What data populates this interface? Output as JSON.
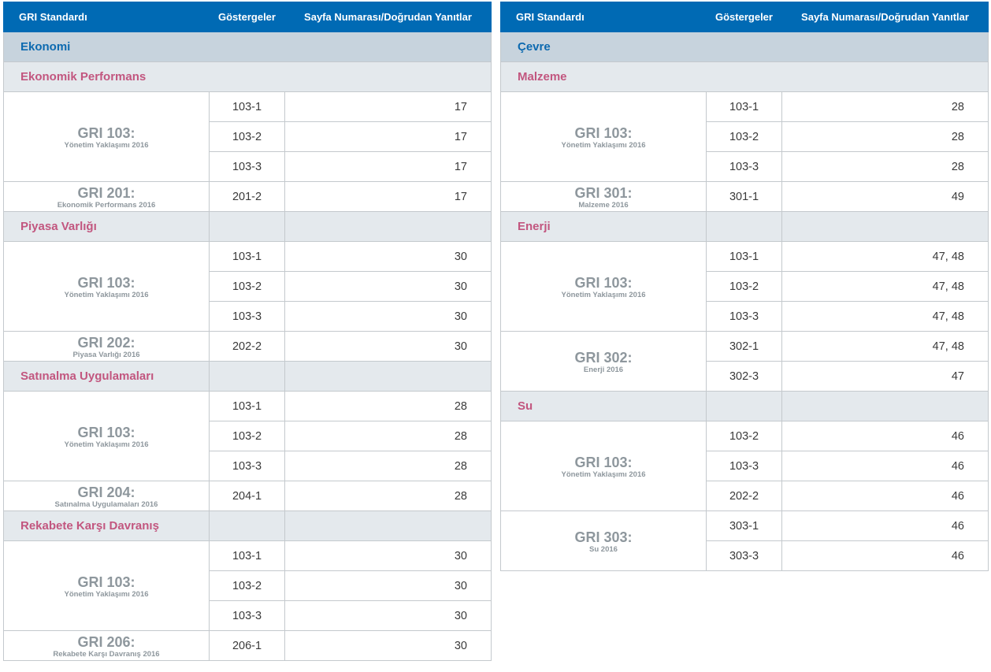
{
  "headers": {
    "standard": "GRI Standardı",
    "indicators": "Göstergeler",
    "pages": "Sayfa Numarası/Doğrudan Yanıtlar"
  },
  "left": {
    "category": "Ekonomi",
    "sections": [
      {
        "title": "Ekonomik Performans",
        "groups": [
          {
            "code": "GRI 103:",
            "name": "Yönetim Yaklaşımı 2016",
            "rows": [
              {
                "ind": "103-1",
                "page": "17"
              },
              {
                "ind": "103-2",
                "page": "17"
              },
              {
                "ind": "103-3",
                "page": "17"
              }
            ]
          },
          {
            "code": "GRI 201:",
            "name": "Ekonomik Performans 2016",
            "rows": [
              {
                "ind": "201-2",
                "page": "17"
              }
            ]
          }
        ]
      },
      {
        "title": "Piyasa Varlığı",
        "groups": [
          {
            "code": "GRI 103:",
            "name": "Yönetim Yaklaşımı 2016",
            "rows": [
              {
                "ind": "103-1",
                "page": "30"
              },
              {
                "ind": "103-2",
                "page": "30"
              },
              {
                "ind": "103-3",
                "page": "30"
              }
            ]
          },
          {
            "code": "GRI 202:",
            "name": "Piyasa Varlığı 2016",
            "rows": [
              {
                "ind": "202-2",
                "page": "30"
              }
            ]
          }
        ]
      },
      {
        "title": "Satınalma Uygulamaları",
        "groups": [
          {
            "code": "GRI 103:",
            "name": "Yönetim Yaklaşımı 2016",
            "rows": [
              {
                "ind": "103-1",
                "page": "28"
              },
              {
                "ind": "103-2",
                "page": "28"
              },
              {
                "ind": "103-3",
                "page": "28"
              }
            ]
          },
          {
            "code": "GRI 204:",
            "name": "Satınalma Uygulamaları 2016",
            "rows": [
              {
                "ind": "204-1",
                "page": "28"
              }
            ]
          }
        ]
      },
      {
        "title": "Rekabete Karşı Davranış",
        "groups": [
          {
            "code": "GRI 103:",
            "name": "Yönetim Yaklaşımı 2016",
            "rows": [
              {
                "ind": "103-1",
                "page": "30"
              },
              {
                "ind": "103-2",
                "page": "30"
              },
              {
                "ind": "103-3",
                "page": "30"
              }
            ]
          },
          {
            "code": "GRI 206:",
            "name": "Rekabete Karşı Davranış 2016",
            "rows": [
              {
                "ind": "206-1",
                "page": "30"
              }
            ]
          }
        ]
      }
    ]
  },
  "right": {
    "category": "Çevre",
    "sections": [
      {
        "title": "Malzeme",
        "groups": [
          {
            "code": "GRI 103:",
            "name": "Yönetim Yaklaşımı 2016",
            "rows": [
              {
                "ind": "103-1",
                "page": "28"
              },
              {
                "ind": "103-2",
                "page": "28"
              },
              {
                "ind": "103-3",
                "page": "28"
              }
            ]
          },
          {
            "code": "GRI 301:",
            "name": "Malzeme 2016",
            "rows": [
              {
                "ind": "301-1",
                "page": "49"
              }
            ]
          }
        ]
      },
      {
        "title": "Enerji",
        "groups": [
          {
            "code": "GRI 103:",
            "name": "Yönetim Yaklaşımı 2016",
            "rows": [
              {
                "ind": "103-1",
                "page": "47, 48"
              },
              {
                "ind": "103-2",
                "page": "47, 48"
              },
              {
                "ind": "103-3",
                "page": "47, 48"
              }
            ]
          },
          {
            "code": "GRI 302:",
            "name": "Enerji 2016",
            "rows": [
              {
                "ind": "302-1",
                "page": "47, 48"
              },
              {
                "ind": "302-3",
                "page": "47"
              }
            ]
          }
        ]
      },
      {
        "title": "Su",
        "groups": [
          {
            "code": "GRI 103:",
            "name": "Yönetim Yaklaşımı 2016",
            "rows": [
              {
                "ind": "103-2",
                "page": "46"
              },
              {
                "ind": "103-3",
                "page": "46"
              },
              {
                "ind": "202-2",
                "page": "46"
              }
            ]
          },
          {
            "code": "GRI 303:",
            "name": "Su 2016",
            "rows": [
              {
                "ind": "303-1",
                "page": "46"
              },
              {
                "ind": "303-3",
                "page": "46"
              }
            ]
          }
        ]
      }
    ]
  }
}
